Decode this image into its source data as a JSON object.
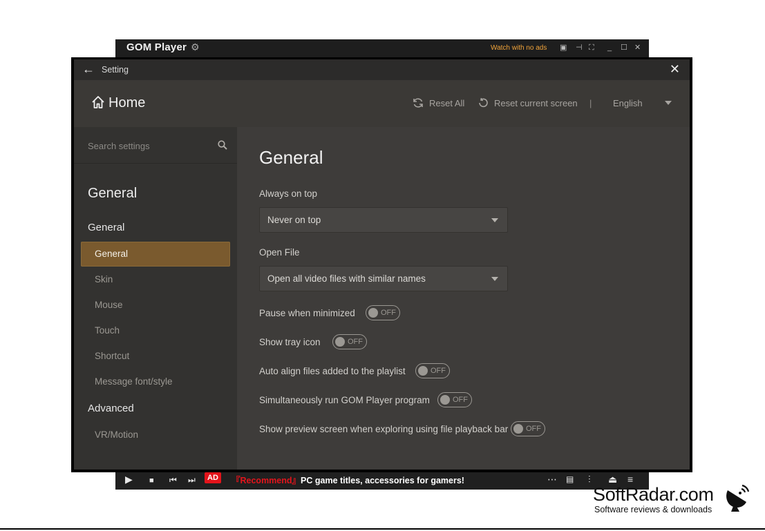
{
  "player": {
    "brand": "GOM Player",
    "watch_no_ads": "Watch with no ads",
    "ad_badge": "AD",
    "ad_recommend": "『Recommend』",
    "ad_text": "PC game titles, accessories for gamers!"
  },
  "dialog": {
    "title": "Setting",
    "header": {
      "home": "Home",
      "reset_all": "Reset All",
      "reset_current": "Reset current screen",
      "separator": "|",
      "language": "English"
    }
  },
  "sidebar": {
    "search_placeholder": "Search settings",
    "section": "General",
    "group_general": "General",
    "items_general": [
      {
        "label": "General",
        "active": true
      },
      {
        "label": "Skin"
      },
      {
        "label": "Mouse"
      },
      {
        "label": "Touch"
      },
      {
        "label": "Shortcut"
      },
      {
        "label": "Message font/style"
      }
    ],
    "group_advanced": "Advanced",
    "items_advanced": [
      {
        "label": "VR/Motion"
      }
    ]
  },
  "main": {
    "title": "General",
    "always_on_top": {
      "label": "Always on top",
      "value": "Never on top"
    },
    "open_file": {
      "label": "Open File",
      "value": "Open all video files with similar names"
    },
    "toggles": [
      {
        "label": "Pause when minimized",
        "state": "OFF"
      },
      {
        "label": "Show tray icon",
        "state": "OFF"
      },
      {
        "label": "Auto align files added to the playlist",
        "state": "OFF"
      },
      {
        "label": "Simultaneously run GOM Player program",
        "state": "OFF"
      },
      {
        "label": "Show preview screen when exploring using file playback bar",
        "state": "OFF"
      }
    ]
  },
  "watermark": {
    "name": "SoftRadar.com",
    "tagline": "Software reviews & downloads"
  },
  "colors": {
    "accent": "#7a5a2e",
    "ad_red": "#e3141b",
    "no_ads_orange": "#f0a33a"
  }
}
